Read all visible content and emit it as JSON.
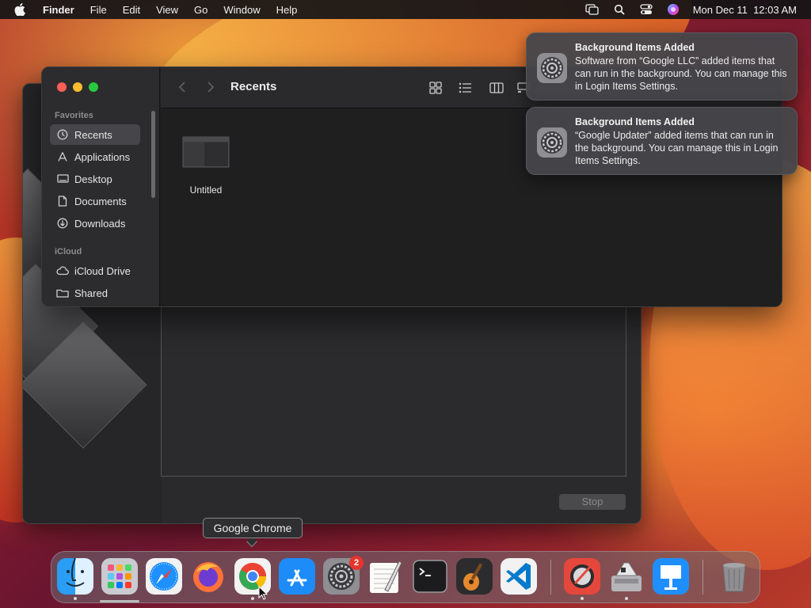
{
  "menubar": {
    "app_name": "Finder",
    "menus": [
      "File",
      "Edit",
      "View",
      "Go",
      "Window",
      "Help"
    ],
    "datetime": "Mon Dec 11  12:03 AM",
    "status_icons": [
      "screen-mirroring-icon",
      "spotlight-icon",
      "control-center-icon",
      "siri-icon"
    ]
  },
  "finder": {
    "title": "Recents",
    "sidebar": {
      "favorites_label": "Favorites",
      "favorites": [
        {
          "label": "Recents",
          "icon": "clock-icon",
          "active": true
        },
        {
          "label": "Applications",
          "icon": "applications-icon"
        },
        {
          "label": "Desktop",
          "icon": "desktop-icon"
        },
        {
          "label": "Documents",
          "icon": "document-icon"
        },
        {
          "label": "Downloads",
          "icon": "download-icon"
        }
      ],
      "icloud_label": "iCloud",
      "icloud": [
        {
          "label": "iCloud Drive",
          "icon": "cloud-icon"
        },
        {
          "label": "Shared",
          "icon": "shared-folder-icon"
        }
      ]
    },
    "files": [
      {
        "name": "Untitled"
      }
    ]
  },
  "installer_window": {
    "stop_label": "Stop"
  },
  "notifications": [
    {
      "title": "Background Items Added",
      "body": "Software from “Google LLC” added items that can run in the background. You can manage this in Login Items Settings."
    },
    {
      "title": "Background Items Added",
      "body": "“Google Updater” added items that can run in the background. You can manage this in Login Items Settings."
    }
  ],
  "dock": {
    "tooltip": "Google Chrome",
    "settings_badge": "2",
    "apps": [
      "Finder",
      "Launchpad",
      "Safari",
      "Firefox",
      "Google Chrome",
      "App Store",
      "System Settings",
      "TextEdit",
      "Terminal",
      "GarageBand",
      "Visual Studio Code",
      "Directory Utility",
      "Boot Camp Assistant",
      "Keynote",
      "Trash"
    ]
  },
  "colors": {
    "accent_red": "#fe5f57",
    "accent_yellow": "#febc2e",
    "accent_green": "#28c840",
    "badge_red": "#e5352e"
  }
}
